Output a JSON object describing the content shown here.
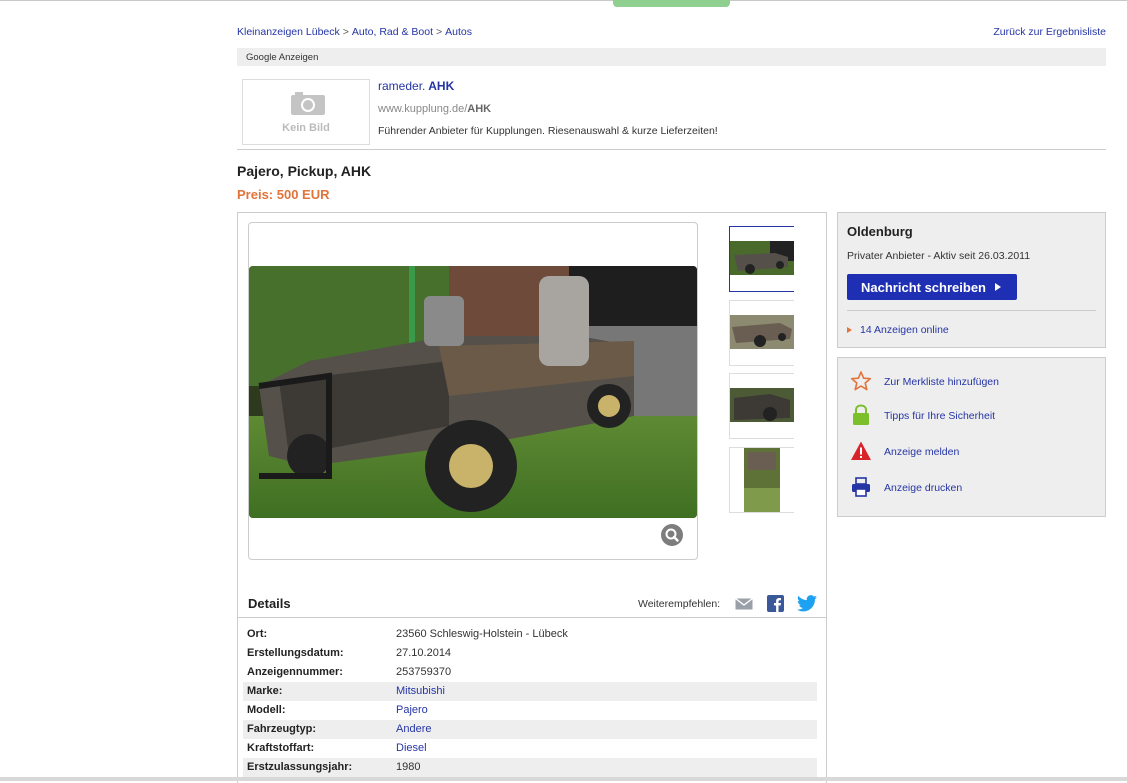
{
  "breadcrumb": [
    "Kleinanzeigen Lübeck",
    "Auto, Rad & Boot",
    "Autos"
  ],
  "breadcrumb_sep": ">",
  "back_link": "Zurück zur Ergebnisliste",
  "ads_label": "Google Anzeigen",
  "ad": {
    "thumb_text": "Kein Bild",
    "title_prefix": "rameder.",
    "title_bold": "AHK",
    "url_prefix": "www.kupplung.de/",
    "url_bold": "AHK",
    "description": "Führender Anbieter für Kupplungen. Riesenauswahl & kurze Lieferzeiten!"
  },
  "listing": {
    "title": "Pajero, Pickup, AHK",
    "price": "Preis: 500 EUR"
  },
  "details": {
    "heading": "Details",
    "share_label": "Weiterempfehlen:",
    "rows": [
      {
        "label": "Ort:",
        "value": "23560 Schleswig-Holstein - Lübeck",
        "link": false,
        "alt": false
      },
      {
        "label": "Erstellungsdatum:",
        "value": "27.10.2014",
        "link": false,
        "alt": false
      },
      {
        "label": "Anzeigennummer:",
        "value": "253759370",
        "link": false,
        "alt": false
      },
      {
        "label": "Marke:",
        "value": "Mitsubishi",
        "link": true,
        "alt": true
      },
      {
        "label": "Modell:",
        "value": "Pajero",
        "link": true,
        "alt": false
      },
      {
        "label": "Fahrzeugtyp:",
        "value": "Andere",
        "link": true,
        "alt": true
      },
      {
        "label": "Kraftstoffart:",
        "value": "Diesel",
        "link": true,
        "alt": false
      },
      {
        "label": "Erstzulassungsjahr:",
        "value": "1980",
        "link": false,
        "alt": true
      }
    ]
  },
  "seller": {
    "city": "Oldenburg",
    "info": "Privater Anbieter - Aktiv seit 26.03.2011",
    "message_button": "Nachricht schreiben",
    "online_link": "14 Anzeigen online"
  },
  "actions": [
    {
      "label": "Zur Merkliste hinzufügen",
      "icon": "star-icon"
    },
    {
      "label": "Tipps für Ihre Sicherheit",
      "icon": "lock-icon"
    },
    {
      "label": "Anzeige melden",
      "icon": "warning-icon"
    },
    {
      "label": "Anzeige drucken",
      "icon": "printer-icon"
    }
  ],
  "colors": {
    "link": "#2535a5",
    "price": "#e2733a",
    "button": "#1e2fb3",
    "panel": "#eeeeee"
  }
}
